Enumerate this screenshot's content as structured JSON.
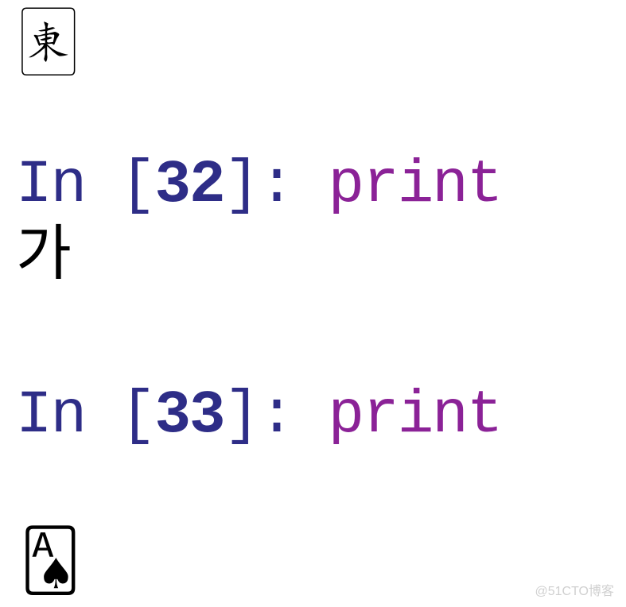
{
  "tiles": {
    "mahjong": "🀀",
    "card": "🂡"
  },
  "code": {
    "line1": {
      "in_text": "In ",
      "bracket_open": "[",
      "number": "32",
      "bracket_close": "]: ",
      "func": "print"
    },
    "output1": "가",
    "line2": {
      "in_text": "In ",
      "bracket_open": "[",
      "number": "33",
      "bracket_close": "]: ",
      "func": "print"
    }
  },
  "watermark": "@51CTO博客"
}
